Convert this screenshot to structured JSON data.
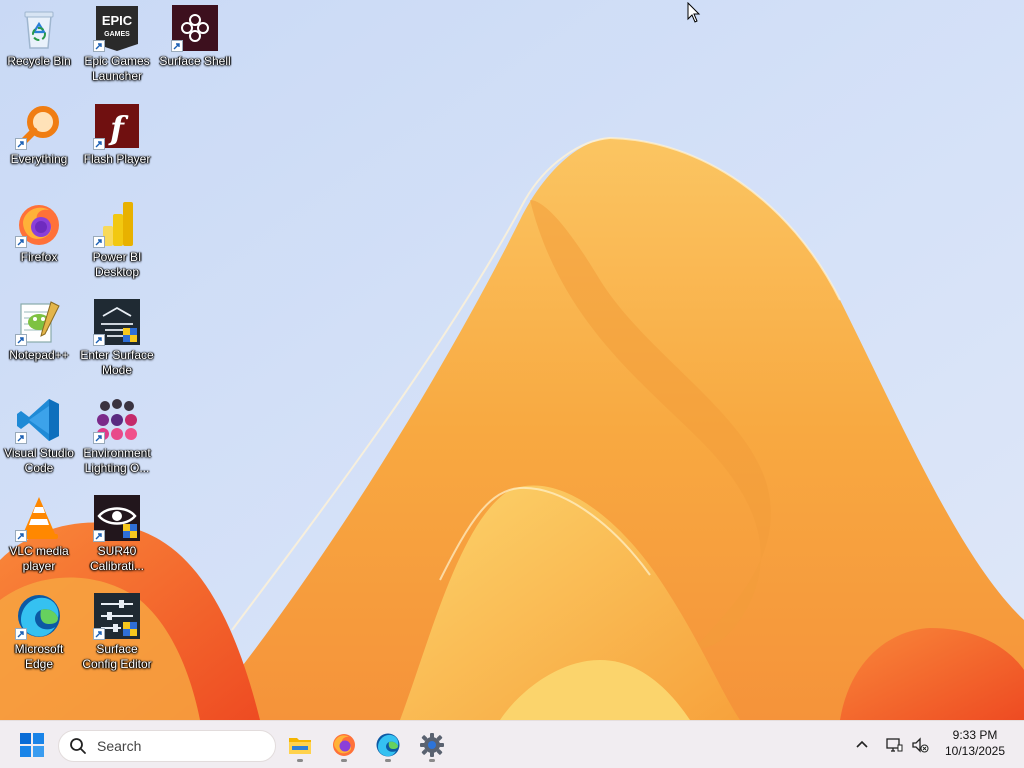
{
  "desktop": {
    "icons": [
      {
        "label": "Recycle Bin",
        "icon": "recycle-bin-icon"
      },
      {
        "label": "Epic Games Launcher",
        "icon": "epic-games-icon"
      },
      {
        "label": "Surface Shell",
        "icon": "surface-shell-icon"
      },
      {
        "label": "Everything",
        "icon": "everything-search-icon"
      },
      {
        "label": "Flash Player",
        "icon": "flash-player-icon"
      },
      {
        "label": "Firefox",
        "icon": "firefox-icon"
      },
      {
        "label": "Power BI Desktop",
        "icon": "power-bi-icon"
      },
      {
        "label": "Notepad++",
        "icon": "notepad-plus-plus-icon"
      },
      {
        "label": "Enter Surface Mode",
        "icon": "enter-surface-mode-icon"
      },
      {
        "label": "Visual Studio Code",
        "icon": "vscode-icon"
      },
      {
        "label": "Environment Lighting O...",
        "icon": "environment-lighting-icon"
      },
      {
        "label": "VLC media player",
        "icon": "vlc-icon"
      },
      {
        "label": "SUR40 Calibrati...",
        "icon": "sur40-calibration-icon"
      },
      {
        "label": "Microsoft Edge",
        "icon": "edge-icon"
      },
      {
        "label": "Surface Config Editor",
        "icon": "surface-config-editor-icon"
      }
    ]
  },
  "taskbar": {
    "start_icon": "windows-start-icon",
    "search_placeholder": "Search",
    "apps": [
      {
        "name": "File Explorer",
        "icon": "file-explorer-icon"
      },
      {
        "name": "Firefox",
        "icon": "firefox-icon"
      },
      {
        "name": "Microsoft Edge",
        "icon": "edge-icon"
      },
      {
        "name": "Settings",
        "icon": "settings-gear-icon"
      }
    ],
    "tray": {
      "chevron_icon": "chevron-up-icon",
      "network_icon": "network-icon",
      "volume_icon": "volume-muted-icon",
      "time": "9:33 PM",
      "date": "10/13/2025"
    }
  },
  "colors": {
    "sky": "#cdddf7",
    "accent_orange": "#f7a93f",
    "deep_orange": "#f06a2a",
    "windows_blue": "#0a6cd6"
  }
}
